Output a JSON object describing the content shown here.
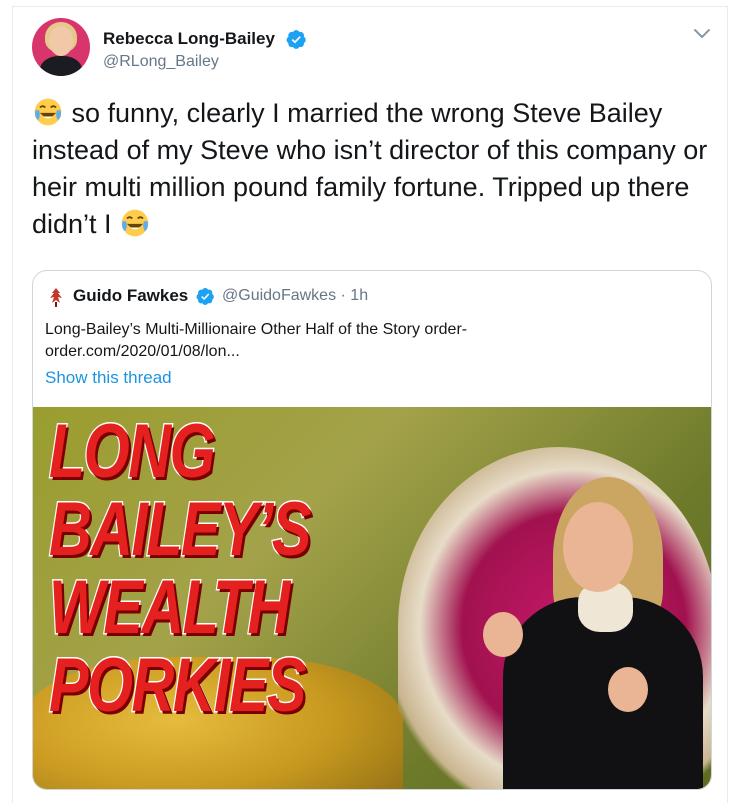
{
  "tweet": {
    "author": {
      "name": "Rebecca Long-Bailey",
      "handle": "@RLong_Bailey"
    },
    "text_main": " so funny,  clearly I married the wrong Steve Bailey instead of my Steve who isn’t director of this company or heir multi million pound family fortune. Tripped up there didn’t I ",
    "emoji": "face-with-tears-of-joy"
  },
  "quote": {
    "author": {
      "name": "Guido Fawkes",
      "handle": "@GuidoFawkes",
      "time": "· 1h"
    },
    "text_line1": "Long-Bailey’s Multi-Millionaire Other Half of the Story order-",
    "text_line2": "order.com/2020/01/08/lon...",
    "show_thread": "Show this thread",
    "image": {
      "headline": [
        "LONG",
        "BAILEY’S",
        "WEALTH",
        "PORKIES"
      ]
    }
  },
  "colors": {
    "verified": "#1da1f2",
    "link": "#1b95e0",
    "secondary_text": "#657786",
    "headline_red": "#e5211f"
  }
}
